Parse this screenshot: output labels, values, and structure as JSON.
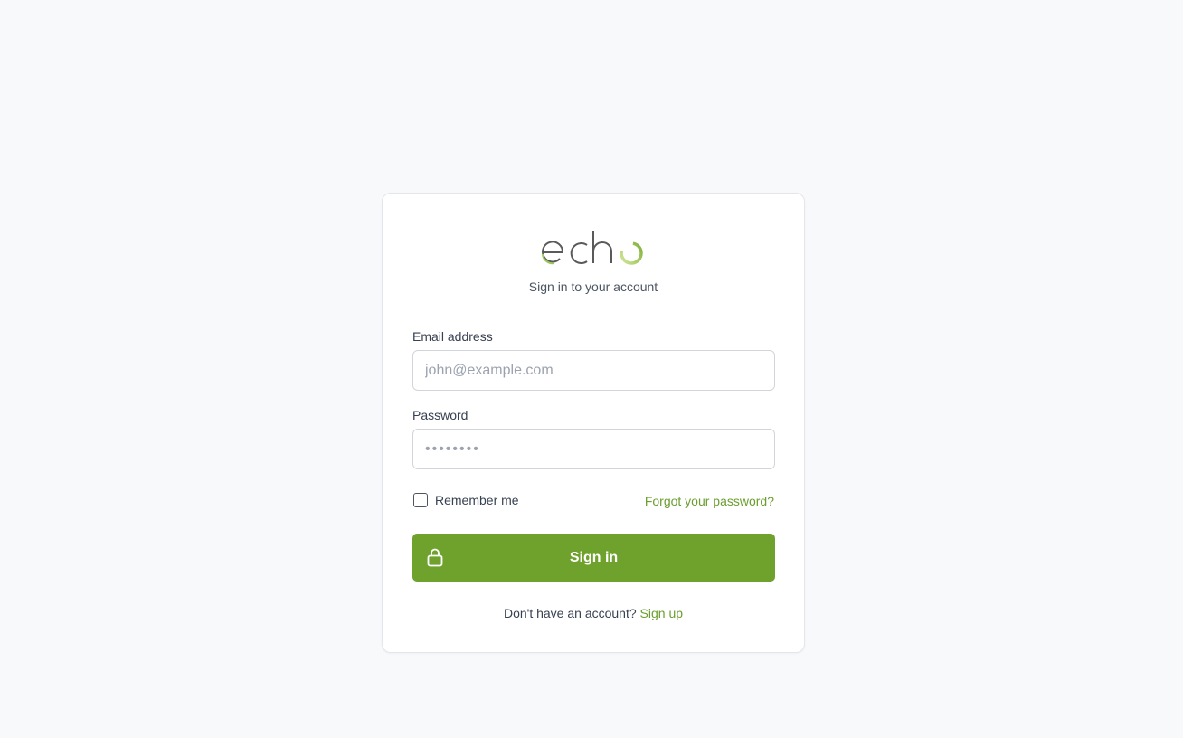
{
  "brand": {
    "logo_text": "echo",
    "accent_color": "#6fa22d",
    "logo_gradient": [
      "#c3d87c",
      "#6fa22d"
    ]
  },
  "login": {
    "subtitle": "Sign in to your account",
    "email_label": "Email address",
    "email_placeholder": "john@example.com",
    "password_label": "Password",
    "password_placeholder": "••••••••",
    "remember_label": "Remember me",
    "remember_checked": false,
    "forgot_link": "Forgot your password?",
    "submit_label": "Sign in",
    "submit_icon": "lock-icon",
    "signup_prompt": "Don't have an account?",
    "signup_link": "Sign up"
  }
}
